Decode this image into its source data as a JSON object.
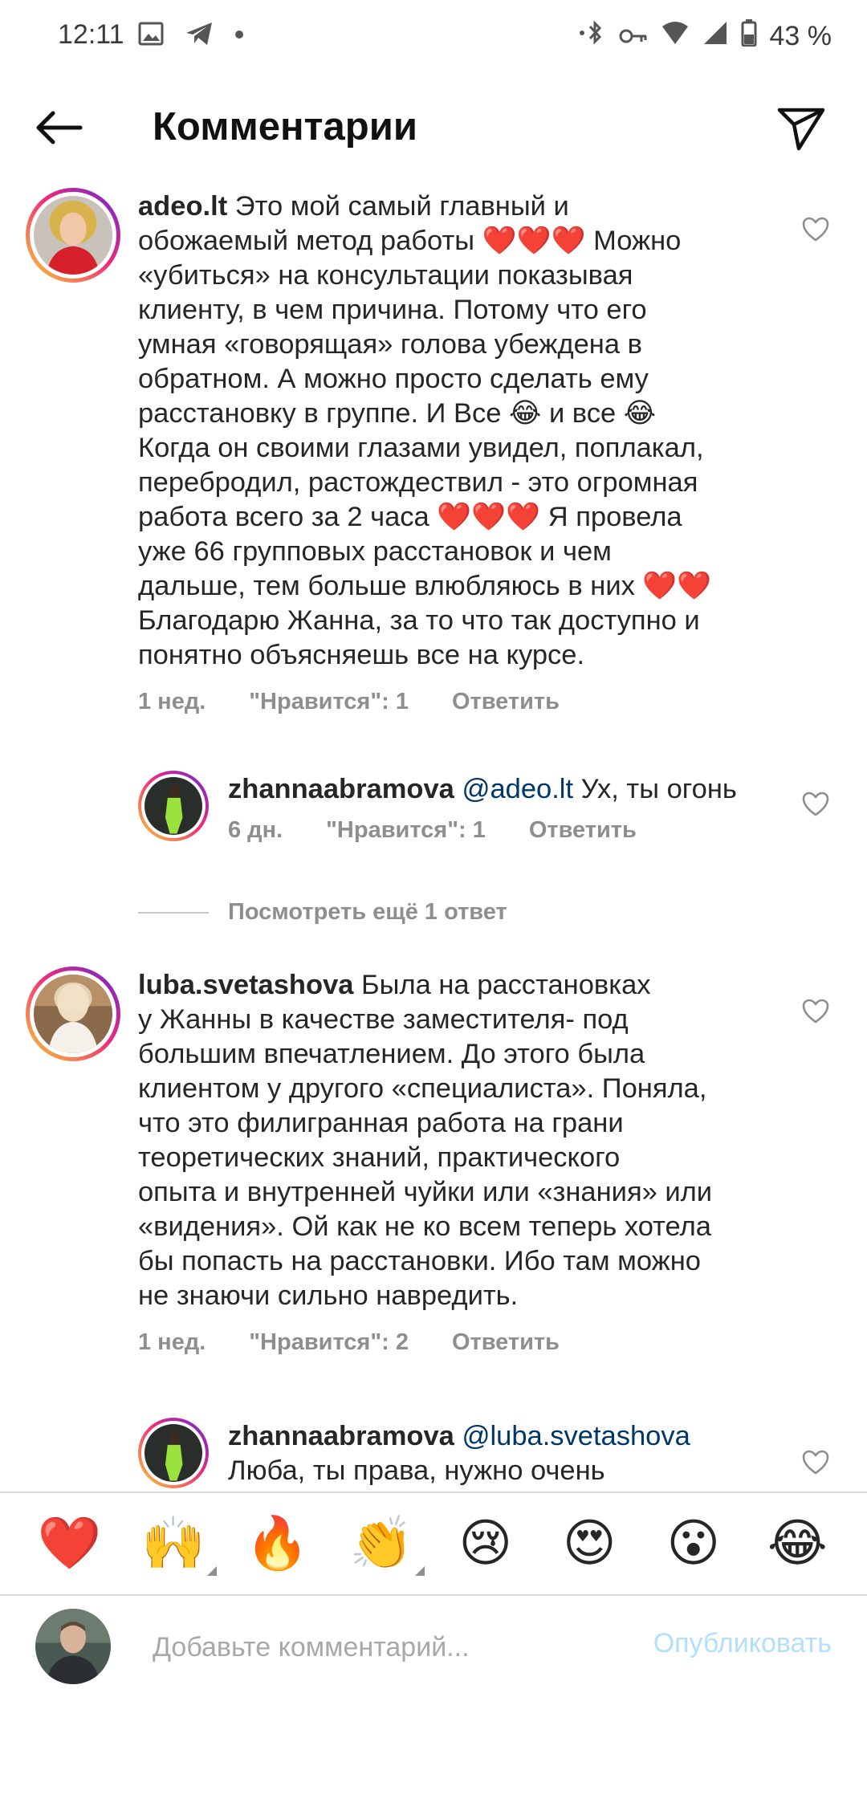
{
  "status_bar": {
    "time": "12:11",
    "battery": "43 %",
    "left_icons": [
      "image-icon",
      "telegram-icon",
      "dot-icon"
    ],
    "right_icons": [
      "bluetooth-icon",
      "key-icon",
      "wifi-icon",
      "signal-icon",
      "battery-icon"
    ]
  },
  "header": {
    "title": "Комментарии",
    "back_icon": "arrow-left-icon",
    "share_icon": "direct-send-icon"
  },
  "comments": [
    {
      "username": "adeo.lt",
      "lines": [
        " Это мой самый главный и",
        "обожаемый метод работы ❤️❤️❤️ Можно",
        "«убиться» на консультации показывая",
        "клиенту, в чем причина. Потому что его",
        "умная «говорящая» голова убеждена в",
        "обратном. А можно просто сделать ему",
        "расстановку в группе. И Все 😂 и все 😂",
        "Когда он своими глазами увидел, поплакал,",
        "перебродил, растождествил - это огромная",
        "работа всего за 2 часа ❤️❤️❤️ Я провела",
        "уже 66 групповых расстановок и чем",
        "дальше, тем больше влюбляюсь в них ❤️❤️",
        "Благодарю Жанна, за то что так доступно и",
        "понятно объясняешь все на курсе."
      ],
      "time": "1 нед.",
      "likes": "\"Нравится\": 1",
      "reply": "Ответить"
    },
    {
      "username": "zhannaabramova",
      "mention": "@adeo.lt",
      "text": " Ух, ты огонь",
      "time": "6 дн.",
      "likes": "\"Нравится\": 1",
      "reply": "Ответить"
    },
    {
      "username": "luba.svetashova",
      "lines": [
        " Была на расстановках",
        "у Жанны в качестве заместителя- под",
        "большим впечатлением. До этого была",
        "клиентом у другого «специалиста». Поняла,",
        "что это филигранная работа на грани",
        "теоретических знаний, практического",
        "опыта и внутренней чуйки или «знания» или",
        "«видения». Ой как не ко всем теперь хотела",
        "бы попасть на расстановки. Ибо там можно",
        "не знаючи сильно навредить."
      ],
      "time": "1 нед.",
      "likes": "\"Нравится\": 2",
      "reply": "Ответить"
    },
    {
      "username": "zhannaabramova",
      "mention": "@luba.svetashova",
      "line2": "Люба, ты права, нужно очень"
    }
  ],
  "more_replies": "Посмотреть ещё 1 ответ",
  "emoji_bar": [
    "❤️",
    "🙌",
    "🔥",
    "👏",
    "😢",
    "😍",
    "😮",
    "😂"
  ],
  "compose": {
    "placeholder": "Добавьте комментарий...",
    "post_label": "Опубликовать"
  },
  "colors": {
    "text": "#262626",
    "secondary": "#8e8e8e",
    "mention": "#00376b",
    "post_disabled": "#b2dffc",
    "divider": "#dbdbdb"
  }
}
